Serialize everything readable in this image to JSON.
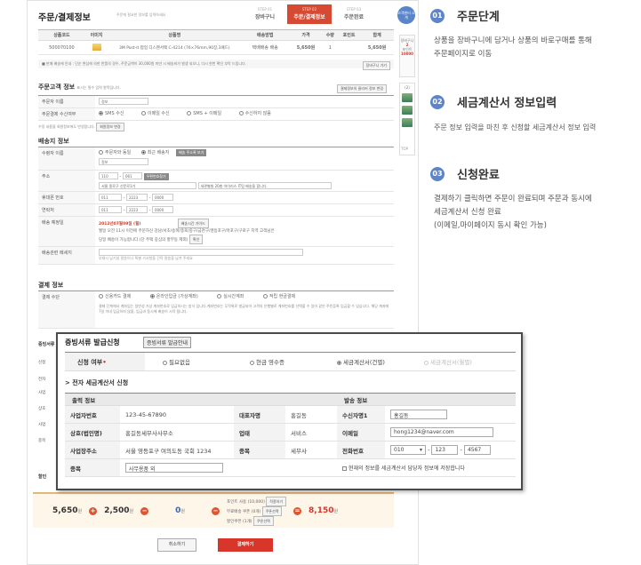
{
  "shot": {
    "title": "주문/결제정보",
    "subtitle": "주문에 필요한 정보를 입력하세요",
    "steps": [
      {
        "no": "STEP 01",
        "label": "장바구니"
      },
      {
        "no": "STEP 02",
        "label": "주문/결제정보"
      },
      {
        "no": "STEP 03",
        "label": "주문완료"
      }
    ],
    "cs_label": "고객센터 소개",
    "side": {
      "line1": "장바구니",
      "count": "2",
      "line2": "포인트",
      "point": "10000"
    },
    "side_count": "(2)",
    "top_label": "TOP",
    "product_headers": [
      "상품코드",
      "이미지",
      "상품명",
      "배송방법",
      "가격",
      "수량",
      "포인트",
      "합계"
    ],
    "product_row": [
      "500070100",
      "",
      "3M Post-it 팝업 디스펜서팩 C-4214 (76×76mm,90장,3패드)",
      "택배배송 배송",
      "5,650원",
      "1",
      "",
      "5,650원"
    ],
    "notice": "■ 판매 배송에 안내 : 단순 변심에 의한 반품의 경우, 주문금액이 30,000원 미만 시 배송비가 발생 되오니, 다시 한번 확인 부탁 드립니다.",
    "notice_btn": "장바구니 가기",
    "orderer": {
      "section": "주문고객 정보",
      "section_note": "표시는 필수 입력 항목입니다.",
      "pw_btn": "결제정보의 클리커 정보 변경",
      "name_label": "주문자 이름",
      "name_value": "정보",
      "recv_label": "주문결제 수신여부",
      "recv_opts": [
        "SMS 수신",
        "이메일 수신",
        "SMS + 이메일",
        "수신하지 않음"
      ],
      "footnote": "수정 내용을 회원정보에도 반영합니다.",
      "footnote_btn": "회원정보 변경"
    },
    "delivery": {
      "section": "배송지 정보",
      "recv_label": "수령자 이름",
      "recv_opts": [
        "주문자와 동일",
        "최근 배송지"
      ],
      "recv_btn": "배송 주소록 보기",
      "recv_value": "정보",
      "addr_label": "주소",
      "zip1": "110",
      "zip2": "061",
      "zip_btn": "우편번호찾기",
      "addr1": "서울 종로구 신문로1가",
      "addr2": "세관별빌 20층 아이리스 IT팀 배송을 합니다.",
      "phone_label": "휴대폰 번호",
      "phone": [
        "011",
        "2223",
        "0000"
      ],
      "tel_label": "연락처",
      "tel": [
        "011",
        "2223",
        "0000"
      ],
      "date_label": "배송 예정일",
      "date_value": "2012년07월09일 (월)",
      "date_btn": "배송시간 가이드",
      "date_note1": "월일 오전 11시 이전에 주문하신 강남/서초/송파/종로/중구/금천구/영등포구/마포구/구로구 지역 고객님은",
      "date_note2": "당일 배송이 가능합니다.(단 주택 중심의 할부동 제외)",
      "date_note_btn": "확인",
      "memo_label": "배송관련 메세지",
      "memo_note": "부재시 남기실 말씀이나 특별 가사항을 간략 말씀을 남겨 주세요"
    },
    "payment": {
      "section": "결제 정보",
      "method_label": "결제 수단",
      "methods": [
        "신용카드 결제",
        "온라인입금 (가상계좌)",
        "실시간계좌",
        "적립 현금결제"
      ],
      "method_note": "결제 단계에서 계좌입는 일반성 가상 계좌번호로 입금하시는 방식 입니다.계좌번호는 무작위로 발급되어 고객의 은행별로 계좌번호를 선택할 수 있어 같은 주민등록 입금할 수 있습니다. 해당 계좌에 7일 이내 입금하지 않을, 입금과 동시에 배송이 시작 됩니다."
    },
    "left_stub": [
      "증빙서류",
      "신청",
      "전자",
      "사업",
      "상호",
      "사업",
      "종목",
      "할인"
    ],
    "totals": {
      "product": "5,650",
      "shipping": "2,500",
      "discount": "0",
      "won": "원",
      "disc_lines": [
        "포인트 사용 (10,000)",
        "무료배송 쿠폰 (0개)",
        "할인쿠폰 (1개)"
      ],
      "disc_btns": [
        "적용하기",
        "쿠폰선택",
        "쿠폰선택"
      ],
      "final": "8,150"
    },
    "cancel_btn": "취소하기",
    "pay_btn": "결제하기"
  },
  "dialog": {
    "title": "증빙서류 발급신청",
    "guide_btn": "증빙서류 발급안내",
    "apply_label": "신청 여부",
    "apply_opts": [
      "필요없음",
      "현금 영수증",
      "세금계산서(건별)",
      "세금계산서(월별)"
    ],
    "sub": "> 전자 세금계산서 신청",
    "col_left": "출력 정보",
    "col_right": "발송 정보",
    "rows": [
      {
        "l1": "사업자번호",
        "v1": "123-45-67890",
        "l2": "대표자명",
        "v2": "홍길동",
        "l3": "수신자명1",
        "v3": "홍길동"
      },
      {
        "l1": "상호(법인명)",
        "v1": "홍길동세무사사무소",
        "l2": "업태",
        "v2": "서비스",
        "l3": "이메일",
        "v3": "hong1234@naver.com"
      },
      {
        "l1": "사업장주소",
        "v1": "서울 영등포구 여의도동 국회 1234",
        "l2": "종목",
        "v2": "세무사",
        "l3": "전화번호",
        "v3": [
          "010",
          "123",
          "4567"
        ]
      }
    ],
    "type_label": "종목",
    "type_value": "사무용품 외",
    "save_check": "현재의 정보를 세금계산서 담당자 정보에 저장합니다"
  },
  "explain": [
    {
      "num": "01",
      "title": "주문단계",
      "lines": [
        "상품을 장바구니에 담거나 상품의 바로구매를 통해",
        "주문페이지로 이동"
      ]
    },
    {
      "num": "02",
      "title": "세금계산서 정보입력",
      "lines": [
        "주문 정보 입력을 마친 후 신청할 세금계산서 정보 입력"
      ]
    },
    {
      "num": "03",
      "title": "신청완료",
      "lines": [
        "결제하기 클릭하면 주문이 완료되며 주문과 동시에",
        "세금계산서 신청 완료",
        "(이메일,마이페이지 동시 확인 가능)"
      ]
    }
  ]
}
